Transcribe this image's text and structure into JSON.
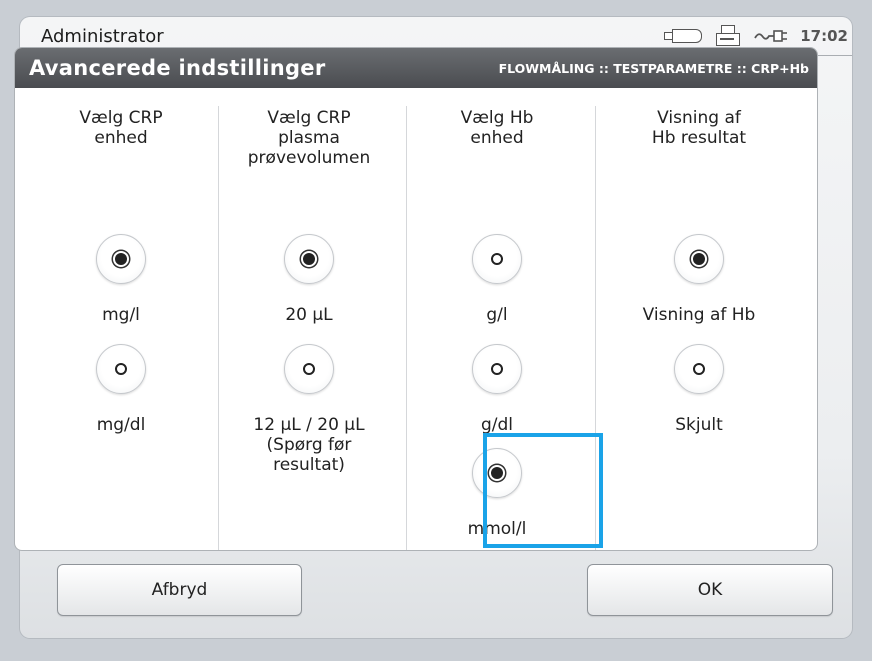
{
  "topbar": {
    "user": "Administrator",
    "time": "17:02"
  },
  "panel": {
    "title": "Avancerede indstillinger",
    "breadcrumb": "FLOWMÅLING :: TESTPARAMETRE :: CRP+Hb"
  },
  "columns": [
    {
      "title": "Vælg CRP\nenhed",
      "options": [
        {
          "label": "mg/l",
          "selected": true
        },
        {
          "label": "mg/dl",
          "selected": false
        }
      ]
    },
    {
      "title": "Vælg CRP\nplasma\nprøvevolumen",
      "options": [
        {
          "label": "20 µL",
          "selected": true
        },
        {
          "label": "12 µL / 20 µL\n(Spørg før\nresultat)",
          "selected": false
        }
      ]
    },
    {
      "title": "Vælg Hb\nenhed",
      "options": [
        {
          "label": "g/l",
          "selected": false
        },
        {
          "label": "g/dl",
          "selected": false
        },
        {
          "label": "mmol/l",
          "selected": true
        }
      ]
    },
    {
      "title": "Visning af\nHb resultat",
      "options": [
        {
          "label": "Visning af Hb",
          "selected": true
        },
        {
          "label": "Skjult",
          "selected": false
        }
      ]
    }
  ],
  "buttons": {
    "cancel": "Afbryd",
    "ok": "OK"
  },
  "highlight_color": "#1aa3e8"
}
